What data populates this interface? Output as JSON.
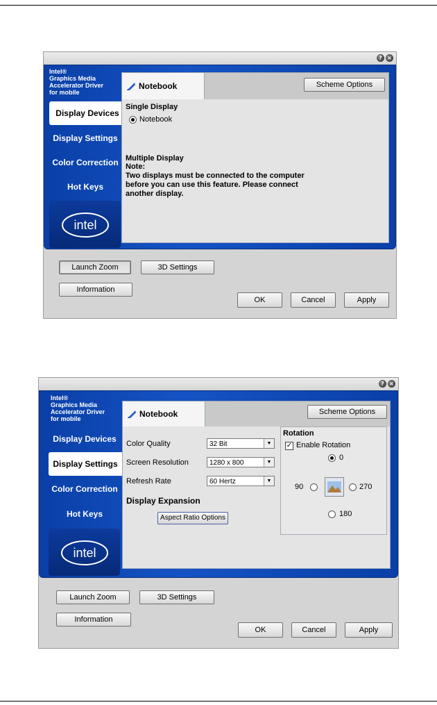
{
  "brand": {
    "line1": "Intel®",
    "line2": "Graphics Media",
    "line3": "Accelerator Driver",
    "line4": "for mobile"
  },
  "nav": [
    "Display Devices",
    "Display Settings",
    "Color Correction",
    "Hot Keys"
  ],
  "logo_text": "intel",
  "title_help": "?",
  "title_close": "×",
  "tab_label": "Notebook",
  "scheme_options": "Scheme Options",
  "buttons": {
    "launch_zoom": "Launch Zoom",
    "settings_3d": "3D Settings",
    "information": "Information",
    "ok": "OK",
    "cancel": "Cancel",
    "apply": "Apply"
  },
  "dialog1": {
    "single_display": "Single Display",
    "notebook_option": "Notebook",
    "multiple_display": "Multiple Display",
    "note": "Note:",
    "note_line1": "Two displays must be connected to the computer",
    "note_line2": "before you can use this feature.  Please connect",
    "note_line3": "another display."
  },
  "dialog2": {
    "color_quality_label": "Color Quality",
    "color_quality_value": "32 Bit",
    "resolution_label": "Screen Resolution",
    "resolution_value": "1280 x 800",
    "refresh_label": "Refresh Rate",
    "refresh_value": "60 Hertz",
    "display_expansion": "Display Expansion",
    "aspect_ratio_button": "Aspect Ratio Options",
    "rotation_title": "Rotation",
    "enable_rotation": "Enable Rotation",
    "rot_0": "0",
    "rot_90": "90",
    "rot_180": "180",
    "rot_270": "270"
  }
}
